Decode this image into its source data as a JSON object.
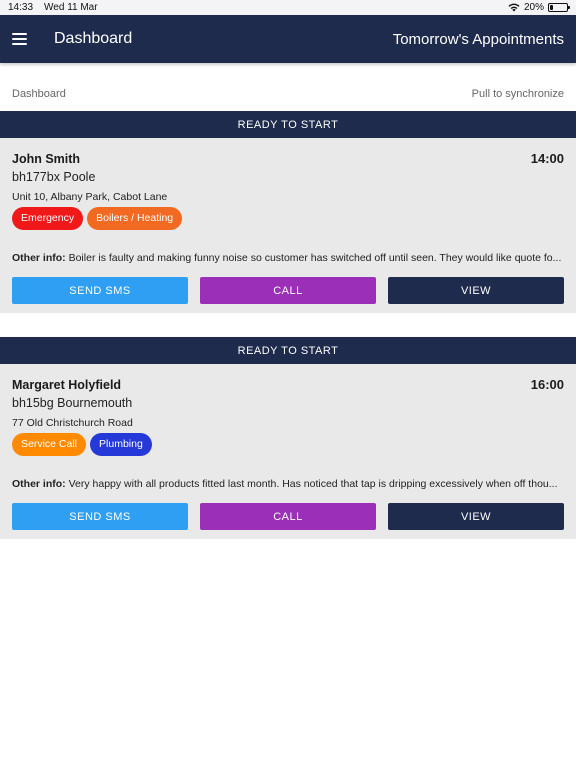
{
  "status_bar": {
    "time": "14:33",
    "date": "Wed 11 Mar",
    "battery": "20%",
    "battery_level": 0.2
  },
  "nav": {
    "title": "Dashboard",
    "right_label": "Tomorrow's Appointments"
  },
  "subheader": {
    "breadcrumb": "Dashboard",
    "sync_hint": "Pull to synchronize"
  },
  "appointments": [
    {
      "status": "READY TO START",
      "name": "John Smith",
      "time": "14:00",
      "postcode": "bh177bx Poole",
      "address": "Unit 10, Albany Park, Cabot Lane",
      "tags": [
        {
          "label": "Emergency",
          "color": "#f01818"
        },
        {
          "label": "Boilers / Heating",
          "color": "#f26a21"
        }
      ],
      "other_info_label": "Other info:",
      "other_info": "Boiler is faulty and making funny noise so customer has switched off until seen. They would like quote fo..."
    },
    {
      "status": "READY TO START",
      "name": "Margaret Holyfield",
      "time": "16:00",
      "postcode": "bh15bg Bournemouth",
      "address": "77 Old Christchurch Road",
      "tags": [
        {
          "label": "Service Call",
          "color": "#ff8a00"
        },
        {
          "label": "Plumbing",
          "color": "#2538d8"
        }
      ],
      "other_info_label": "Other info:",
      "other_info": "Very happy with all products fitted last month. Has noticed that tap is dripping excessively when off thou..."
    }
  ],
  "buttons": {
    "sms": {
      "label": "SEND SMS",
      "color": "#2e9ff2"
    },
    "call": {
      "label": "CALL",
      "color": "#9b2fb8"
    },
    "view": {
      "label": "VIEW",
      "color": "#1f2b4d"
    }
  }
}
